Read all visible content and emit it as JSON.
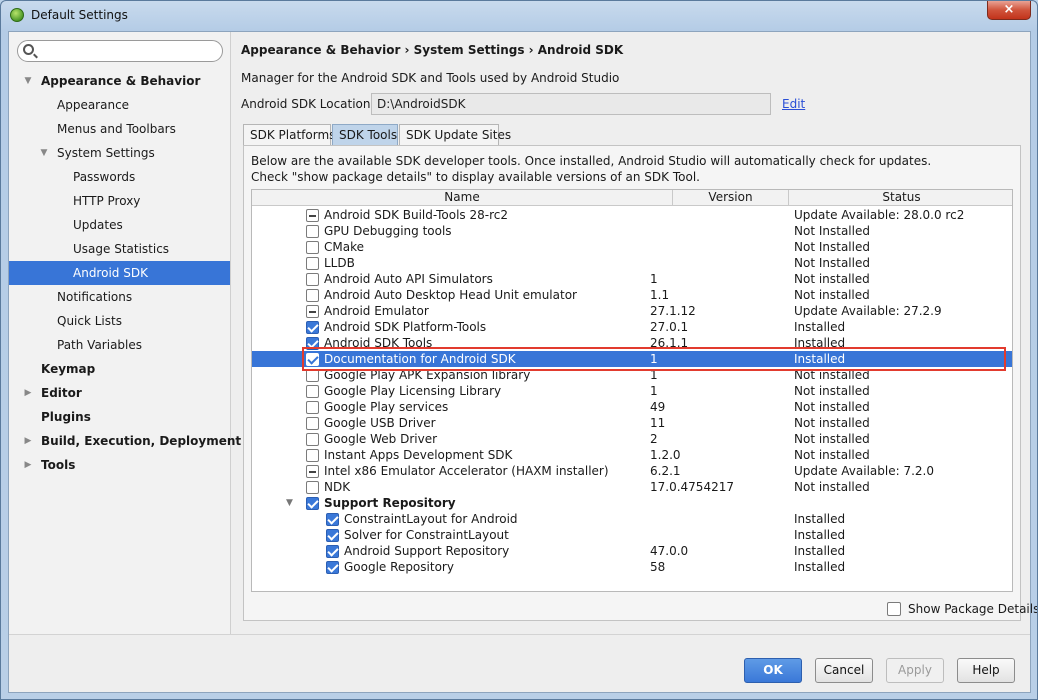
{
  "window": {
    "title": "Default Settings",
    "close_symbol": "×"
  },
  "search": {
    "placeholder": ""
  },
  "sidebar": {
    "items": [
      {
        "label": "Appearance & Behavior",
        "level": 0,
        "bold": true,
        "arrow": "▼",
        "selected": false
      },
      {
        "label": "Appearance",
        "level": 1,
        "bold": false,
        "arrow": "",
        "selected": false
      },
      {
        "label": "Menus and Toolbars",
        "level": 1,
        "bold": false,
        "arrow": "",
        "selected": false
      },
      {
        "label": "System Settings",
        "level": 1,
        "bold": false,
        "arrow": "▼",
        "selected": false
      },
      {
        "label": "Passwords",
        "level": 2,
        "bold": false,
        "arrow": "",
        "selected": false
      },
      {
        "label": "HTTP Proxy",
        "level": 2,
        "bold": false,
        "arrow": "",
        "selected": false
      },
      {
        "label": "Updates",
        "level": 2,
        "bold": false,
        "arrow": "",
        "selected": false
      },
      {
        "label": "Usage Statistics",
        "level": 2,
        "bold": false,
        "arrow": "",
        "selected": false
      },
      {
        "label": "Android SDK",
        "level": 2,
        "bold": false,
        "arrow": "",
        "selected": true
      },
      {
        "label": "Notifications",
        "level": 1,
        "bold": false,
        "arrow": "",
        "selected": false
      },
      {
        "label": "Quick Lists",
        "level": 1,
        "bold": false,
        "arrow": "",
        "selected": false
      },
      {
        "label": "Path Variables",
        "level": 1,
        "bold": false,
        "arrow": "",
        "selected": false
      },
      {
        "label": "Keymap",
        "level": 0,
        "bold": true,
        "arrow": "",
        "selected": false
      },
      {
        "label": "Editor",
        "level": 0,
        "bold": true,
        "arrow": "▶",
        "selected": false
      },
      {
        "label": "Plugins",
        "level": 0,
        "bold": true,
        "arrow": "",
        "selected": false
      },
      {
        "label": "Build, Execution, Deployment",
        "level": 0,
        "bold": true,
        "arrow": "▶",
        "selected": false
      },
      {
        "label": "Tools",
        "level": 0,
        "bold": true,
        "arrow": "▶",
        "selected": false
      }
    ]
  },
  "main": {
    "breadcrumb": "Appearance & Behavior › System Settings › Android SDK",
    "description": "Manager for the Android SDK and Tools used by Android Studio",
    "location_label": "Android SDK Location:",
    "location_value": "D:\\AndroidSDK",
    "edit_label": "Edit",
    "tabs": [
      {
        "label": "SDK Platforms",
        "active": false
      },
      {
        "label": "SDK Tools",
        "active": true
      },
      {
        "label": "SDK Update Sites",
        "active": false
      }
    ],
    "info_line1": "Below are the available SDK developer tools. Once installed, Android Studio will automatically check for updates.",
    "info_line2": "Check \"show package details\" to display available versions of an SDK Tool.",
    "columns": {
      "name": "Name",
      "version": "Version",
      "status": "Status"
    },
    "rows": [
      {
        "name": "Android SDK Build-Tools 28-rc2",
        "version": "",
        "status": "Update Available: 28.0.0 rc2",
        "check": "partial",
        "indent": 0
      },
      {
        "name": "GPU Debugging tools",
        "version": "",
        "status": "Not Installed",
        "check": "none",
        "indent": 0
      },
      {
        "name": "CMake",
        "version": "",
        "status": "Not Installed",
        "check": "none",
        "indent": 0
      },
      {
        "name": "LLDB",
        "version": "",
        "status": "Not Installed",
        "check": "none",
        "indent": 0
      },
      {
        "name": "Android Auto API Simulators",
        "version": "1",
        "status": "Not installed",
        "check": "none",
        "indent": 0
      },
      {
        "name": "Android Auto Desktop Head Unit emulator",
        "version": "1.1",
        "status": "Not installed",
        "check": "none",
        "indent": 0
      },
      {
        "name": "Android Emulator",
        "version": "27.1.12",
        "status": "Update Available: 27.2.9",
        "check": "partial",
        "indent": 0
      },
      {
        "name": "Android SDK Platform-Tools",
        "version": "27.0.1",
        "status": "Installed",
        "check": "checked",
        "indent": 0
      },
      {
        "name": "Android SDK Tools",
        "version": "26.1.1",
        "status": "Installed",
        "check": "checked",
        "indent": 0
      },
      {
        "name": "Documentation for Android SDK",
        "version": "1",
        "status": "Installed",
        "check": "checked",
        "indent": 0,
        "selected": true
      },
      {
        "name": "Google Play APK Expansion library",
        "version": "1",
        "status": "Not installed",
        "check": "none",
        "indent": 0
      },
      {
        "name": "Google Play Licensing Library",
        "version": "1",
        "status": "Not installed",
        "check": "none",
        "indent": 0
      },
      {
        "name": "Google Play services",
        "version": "49",
        "status": "Not installed",
        "check": "none",
        "indent": 0
      },
      {
        "name": "Google USB Driver",
        "version": "11",
        "status": "Not installed",
        "check": "none",
        "indent": 0
      },
      {
        "name": "Google Web Driver",
        "version": "2",
        "status": "Not installed",
        "check": "none",
        "indent": 0
      },
      {
        "name": "Instant Apps Development SDK",
        "version": "1.2.0",
        "status": "Not installed",
        "check": "none",
        "indent": 0
      },
      {
        "name": "Intel x86 Emulator Accelerator (HAXM installer)",
        "version": "6.2.1",
        "status": "Update Available: 7.2.0",
        "check": "partial",
        "indent": 0
      },
      {
        "name": "NDK",
        "version": "17.0.4754217",
        "status": "Not installed",
        "check": "none",
        "indent": 0
      },
      {
        "name": "Support Repository",
        "version": "",
        "status": "",
        "check": "checked",
        "indent": 0,
        "bold": true,
        "expander": "▼"
      },
      {
        "name": "ConstraintLayout for Android",
        "version": "",
        "status": "Installed",
        "check": "checked",
        "indent": 1
      },
      {
        "name": "Solver for ConstraintLayout",
        "version": "",
        "status": "Installed",
        "check": "checked",
        "indent": 1
      },
      {
        "name": "Android Support Repository",
        "version": "47.0.0",
        "status": "Installed",
        "check": "checked",
        "indent": 1
      },
      {
        "name": "Google Repository",
        "version": "58",
        "status": "Installed",
        "check": "checked",
        "indent": 1
      }
    ],
    "show_details_label": "Show Package Details"
  },
  "footer": {
    "ok": "OK",
    "cancel": "Cancel",
    "apply": "Apply",
    "help": "Help"
  },
  "colors": {
    "selection": "#3875d7",
    "highlight_border": "#e23b2e",
    "link": "#2a4fd6"
  }
}
